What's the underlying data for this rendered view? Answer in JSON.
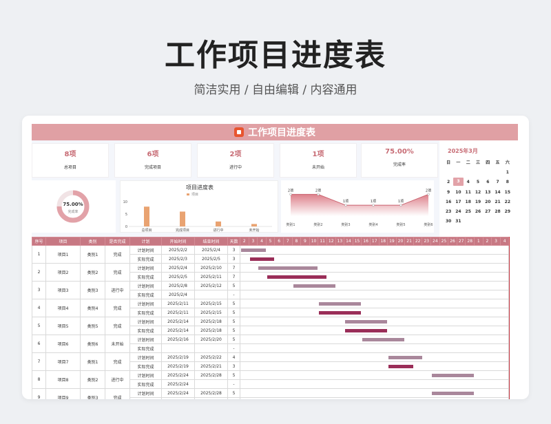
{
  "hero": {
    "title": "工作项目进度表",
    "subtitle": "简洁实用 / 自由编辑 / 内容通用"
  },
  "sheet_title": "工作项目进度表",
  "stats": [
    {
      "value": "8项",
      "label": "总项目"
    },
    {
      "value": "6项",
      "label": "完成项目"
    },
    {
      "value": "2项",
      "label": "进行中"
    },
    {
      "value": "1项",
      "label": "未开始"
    },
    {
      "value": "75.00%",
      "label": "完成率"
    }
  ],
  "calendar": {
    "title": "2025年3月",
    "weekdays": [
      "日",
      "一",
      "二",
      "三",
      "四",
      "五",
      "六"
    ],
    "rows": [
      [
        "",
        "",
        "",
        "",
        "",
        "",
        "1"
      ],
      [
        "2",
        "3",
        "4",
        "5",
        "6",
        "7",
        "8"
      ],
      [
        "9",
        "10",
        "11",
        "12",
        "13",
        "14",
        "15"
      ],
      [
        "16",
        "17",
        "18",
        "19",
        "20",
        "21",
        "22"
      ],
      [
        "23",
        "24",
        "25",
        "26",
        "27",
        "28",
        "29"
      ],
      [
        "30",
        "31",
        "",
        "",
        "",
        "",
        ""
      ]
    ],
    "today": "3"
  },
  "donut": {
    "value": "75.00%",
    "label": "完成率",
    "ratio": 0.75,
    "color": "#e2a2a8"
  },
  "progress_chart": {
    "title": "项目进度表",
    "legend": "项目",
    "ticks": [
      "10",
      "5",
      "0"
    ],
    "categories": [
      "总项目",
      "完成项目",
      "进行中",
      "未开始"
    ],
    "values": [
      8,
      6,
      2,
      1
    ],
    "max": 10
  },
  "area_chart": {
    "labels": [
      "2项",
      "2项",
      "1项",
      "1项",
      "1项",
      "2项"
    ],
    "categories": [
      "类别1",
      "类别2",
      "类别3",
      "类别4",
      "类别5",
      "类别6"
    ],
    "values": [
      2,
      2,
      1,
      1,
      1,
      2
    ]
  },
  "chart_data": [
    {
      "type": "bar",
      "title": "项目进度表",
      "categories": [
        "总项目",
        "完成项目",
        "进行中",
        "未开始"
      ],
      "series": [
        {
          "name": "项目",
          "values": [
            8,
            6,
            2,
            1
          ]
        }
      ],
      "ylim": [
        0,
        10
      ]
    },
    {
      "type": "area",
      "categories": [
        "类别1",
        "类别2",
        "类别3",
        "类别4",
        "类别5",
        "类别6"
      ],
      "values": [
        2,
        2,
        1,
        1,
        1,
        2
      ]
    },
    {
      "type": "pie",
      "categories": [
        "完成率"
      ],
      "values": [
        75
      ]
    }
  ],
  "table": {
    "headers": [
      "序号",
      "项目",
      "类别",
      "是否完成",
      "计划",
      "开始时间",
      "结束时间",
      "天数"
    ],
    "days": [
      "2",
      "3",
      "4",
      "5",
      "6",
      "7",
      "8",
      "9",
      "10",
      "11",
      "12",
      "13",
      "14",
      "15",
      "16",
      "17",
      "18",
      "19",
      "20",
      "21",
      "22",
      "23",
      "24",
      "25",
      "26",
      "27",
      "28",
      "1",
      "2",
      "3",
      "4"
    ],
    "plan_label": "计划时间",
    "real_label": "实际完成",
    "projects": [
      {
        "no": "1",
        "name": "项目1",
        "cat": "类别1",
        "status": "完成",
        "plan": [
          "2025/2/2",
          "2025/2/4",
          "3"
        ],
        "real": [
          "2025/2/3",
          "2025/2/5",
          "3"
        ],
        "plan_bar": [
          0,
          3
        ],
        "real_bar": [
          1,
          3
        ]
      },
      {
        "no": "2",
        "name": "项目2",
        "cat": "类别2",
        "status": "完成",
        "plan": [
          "2025/2/4",
          "2025/2/10",
          "7"
        ],
        "real": [
          "2025/2/5",
          "2025/2/11",
          "7"
        ],
        "plan_bar": [
          2,
          7
        ],
        "real_bar": [
          3,
          7
        ]
      },
      {
        "no": "3",
        "name": "项目3",
        "cat": "类别3",
        "status": "进行中",
        "plan": [
          "2025/2/8",
          "2025/2/12",
          "5"
        ],
        "real": [
          "2025/2/4",
          "",
          "-"
        ],
        "plan_bar": [
          6,
          5
        ],
        "real_bar": null
      },
      {
        "no": "4",
        "name": "项目4",
        "cat": "类别4",
        "status": "完成",
        "plan": [
          "2025/2/11",
          "2025/2/15",
          "5"
        ],
        "real": [
          "2025/2/11",
          "2025/2/15",
          "5"
        ],
        "plan_bar": [
          9,
          5
        ],
        "real_bar": [
          9,
          5
        ]
      },
      {
        "no": "5",
        "name": "项目5",
        "cat": "类别5",
        "status": "完成",
        "plan": [
          "2025/2/14",
          "2025/2/18",
          "5"
        ],
        "real": [
          "2025/2/14",
          "2025/2/18",
          "5"
        ],
        "plan_bar": [
          12,
          5
        ],
        "real_bar": [
          12,
          5
        ]
      },
      {
        "no": "6",
        "name": "项目6",
        "cat": "类别6",
        "status": "未开始",
        "plan": [
          "2025/2/16",
          "2025/2/20",
          "5"
        ],
        "real": [
          "",
          "",
          "-"
        ],
        "plan_bar": [
          14,
          5
        ],
        "real_bar": null
      },
      {
        "no": "7",
        "name": "项目7",
        "cat": "类别1",
        "status": "完成",
        "plan": [
          "2025/2/19",
          "2025/2/22",
          "4"
        ],
        "real": [
          "2025/2/19",
          "2025/2/21",
          "3"
        ],
        "plan_bar": [
          17,
          4
        ],
        "real_bar": [
          17,
          3
        ]
      },
      {
        "no": "8",
        "name": "项目8",
        "cat": "类别2",
        "status": "进行中",
        "plan": [
          "2025/2/24",
          "2025/2/28",
          "5"
        ],
        "real": [
          "2025/2/24",
          "",
          "-"
        ],
        "plan_bar": [
          22,
          5
        ],
        "real_bar": null
      },
      {
        "no": "9",
        "name": "项目9",
        "cat": "类别3",
        "status": "完成",
        "plan": [
          "2025/2/24",
          "2025/2/28",
          "5"
        ],
        "real": [
          "",
          "",
          ""
        ],
        "plan_bar": [
          22,
          5
        ],
        "real_bar": null
      }
    ]
  }
}
